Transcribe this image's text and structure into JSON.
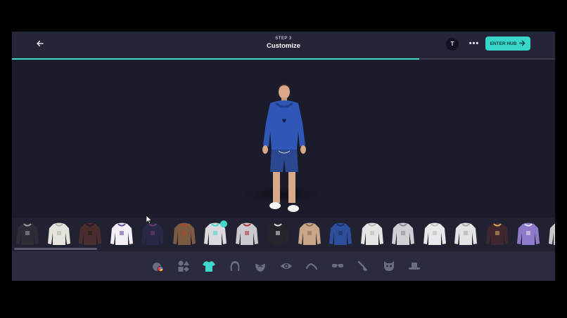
{
  "header": {
    "step": "STEP 3",
    "title": "Customize",
    "profile_initial": "T",
    "more_label": "•••",
    "enter_hub_label": "ENTER HUB"
  },
  "progress": {
    "fraction": 0.75
  },
  "colors": {
    "accent": "#3fd9cb",
    "background": "#1a1b2b",
    "topbar": "#242536",
    "category_bar": "#2a2b3e"
  },
  "outfits": [
    {
      "name": "outfit-1",
      "body": "#2d2d35",
      "accent": "#9a9aa4"
    },
    {
      "name": "outfit-2",
      "body": "#e5e3dc",
      "accent": "#b8b6ae"
    },
    {
      "name": "outfit-3",
      "body": "#4a2d2e",
      "accent": "#2a1c1f"
    },
    {
      "name": "outfit-4",
      "body": "#f2f0f6",
      "accent": "#6a4f99"
    },
    {
      "name": "outfit-5",
      "body": "#262845",
      "accent": "#6e3d63"
    },
    {
      "name": "outfit-6",
      "body": "#7a5a41",
      "accent": "#b04a2a"
    },
    {
      "name": "outfit-7",
      "body": "#dadadf",
      "accent": "#3fd9cb"
    },
    {
      "name": "outfit-8",
      "body": "#c9c9cf",
      "accent": "#b33a3a"
    },
    {
      "name": "outfit-9",
      "body": "#23252c",
      "accent": "#d8d8d8"
    },
    {
      "name": "outfit-10",
      "body": "#c9a68a",
      "accent": "#8a6c55"
    },
    {
      "name": "outfit-11",
      "body": "#2d4f9c",
      "accent": "#1c2f66"
    },
    {
      "name": "outfit-12",
      "body": "#e5e5e2",
      "accent": "#b9b9b5"
    },
    {
      "name": "outfit-13",
      "body": "#cfcfd4",
      "accent": "#8e8e96"
    },
    {
      "name": "outfit-14",
      "body": "#e9e9ec",
      "accent": "#bdbdc2"
    },
    {
      "name": "outfit-15",
      "body": "#e3e3e6",
      "accent": "#a9a9ae"
    },
    {
      "name": "outfit-16",
      "body": "#3f2631",
      "accent": "#d3a45c"
    },
    {
      "name": "outfit-17",
      "body": "#8e7ac9",
      "accent": "#e3e0ee"
    },
    {
      "name": "outfit-18",
      "body": "#c9c9cd",
      "accent": "#8a8a90"
    }
  ],
  "categories": [
    {
      "name": "skin",
      "icon": "skin-tone-icon"
    },
    {
      "name": "shapes",
      "icon": "shapes-icon"
    },
    {
      "name": "outfit",
      "icon": "tshirt-icon",
      "active": true
    },
    {
      "name": "hair",
      "icon": "hair-icon"
    },
    {
      "name": "beard",
      "icon": "beard-icon"
    },
    {
      "name": "eyes",
      "icon": "eye-icon"
    },
    {
      "name": "eyebrows",
      "icon": "eyebrow-icon"
    },
    {
      "name": "glasses",
      "icon": "glasses-icon"
    },
    {
      "name": "face-paint",
      "icon": "brush-icon"
    },
    {
      "name": "mask",
      "icon": "mask-icon"
    },
    {
      "name": "hat",
      "icon": "hat-icon"
    }
  ]
}
